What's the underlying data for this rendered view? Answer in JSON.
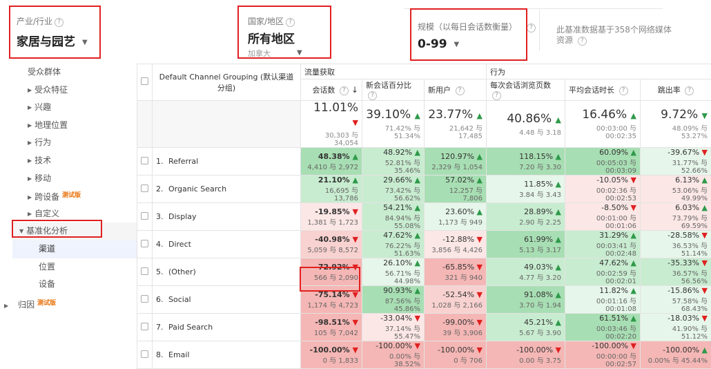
{
  "filters": {
    "industry": {
      "label": "产业/行业",
      "value": "家居与园艺"
    },
    "region": {
      "label": "国家/地区",
      "value": "所有地区",
      "sub": "加拿大"
    },
    "scale": {
      "label": "规模（以每日会话数衡量）",
      "value": "0-99"
    },
    "note": "此基准数据基于358个网络媒体资源",
    "help_glyph": "?"
  },
  "sidebar": {
    "header": "受众群体",
    "items": [
      "受众特征",
      "兴趣",
      "地理位置",
      "行为",
      "技术",
      "移动",
      "跨设备",
      "自定义"
    ],
    "beta_label": "测试版",
    "group": "基准化分析",
    "sub_items": [
      "渠道",
      "位置",
      "设备"
    ],
    "last_item": "归因"
  },
  "table": {
    "dimension_header": "Default Channel Grouping (默认渠道分组)",
    "group_acquisition": "流量获取",
    "group_behavior": "行为",
    "columns": [
      "会话数",
      "新会话百分比",
      "新用户",
      "每次会话浏览页数",
      "平均会话时长",
      "跳出率"
    ],
    "totals": [
      {
        "pct": "11.01%",
        "dir": "down",
        "sub": "30,303 与 34,054"
      },
      {
        "pct": "39.10%",
        "dir": "up",
        "sub": "71.42% 与 51.34%"
      },
      {
        "pct": "23.77%",
        "dir": "up",
        "sub": "21,642 与 17,485"
      },
      {
        "pct": "40.86%",
        "dir": "up",
        "sub": "4.48 与 3.18"
      },
      {
        "pct": "16.46%",
        "dir": "up",
        "sub": "00:03:00 与 00:02:35"
      },
      {
        "pct": "9.72%",
        "dir": "up",
        "sub": "48.09% 与 53.27%"
      }
    ],
    "rows": [
      {
        "idx": "1.",
        "name": "Referral",
        "cells": [
          {
            "pct": "48.38%",
            "dir": "up",
            "sub": "4,410 与 2,972"
          },
          {
            "pct": "48.92%",
            "dir": "up",
            "sub": "52.81% 与 35.46%"
          },
          {
            "pct": "120.97%",
            "dir": "up",
            "sub": "2,329 与 1,054"
          },
          {
            "pct": "118.15%",
            "dir": "up",
            "sub": "7.20 与 3.30"
          },
          {
            "pct": "60.09%",
            "dir": "up",
            "sub": "00:05:03 与 00:03:09"
          },
          {
            "pct": "-39.67%",
            "dir": "down",
            "sub": "31.77% 与 52.66%"
          }
        ]
      },
      {
        "idx": "2.",
        "name": "Organic Search",
        "cells": [
          {
            "pct": "21.10%",
            "dir": "up",
            "sub": "16,695 与 13,786"
          },
          {
            "pct": "29.66%",
            "dir": "up",
            "sub": "73.42% 与 56.62%"
          },
          {
            "pct": "57.02%",
            "dir": "up",
            "sub": "12,257 与 7,806"
          },
          {
            "pct": "11.85%",
            "dir": "up",
            "sub": "3.84 与 3.43"
          },
          {
            "pct": "-10.05%",
            "dir": "down",
            "sub": "00:02:36 与 00:02:53"
          },
          {
            "pct": "6.13%",
            "dir": "up",
            "sub": "53.06% 与 49.99%"
          }
        ]
      },
      {
        "idx": "3.",
        "name": "Display",
        "cells": [
          {
            "pct": "-19.85%",
            "dir": "down",
            "sub": "1,381 与 1,723"
          },
          {
            "pct": "54.21%",
            "dir": "up",
            "sub": "84.94% 与 55.08%"
          },
          {
            "pct": "23.60%",
            "dir": "up",
            "sub": "1,173 与 949"
          },
          {
            "pct": "28.89%",
            "dir": "up",
            "sub": "2.90 与 2.25"
          },
          {
            "pct": "-8.50%",
            "dir": "down",
            "sub": "00:01:00 与 00:01:06"
          },
          {
            "pct": "6.03%",
            "dir": "up",
            "sub": "73.79% 与 69.59%"
          }
        ]
      },
      {
        "idx": "4.",
        "name": "Direct",
        "cells": [
          {
            "pct": "-40.98%",
            "dir": "down",
            "sub": "5,059 与 8,572"
          },
          {
            "pct": "47.62%",
            "dir": "up",
            "sub": "76.22% 与 51.63%"
          },
          {
            "pct": "-12.88%",
            "dir": "down",
            "sub": "3,856 与 4,426"
          },
          {
            "pct": "61.99%",
            "dir": "up",
            "sub": "5.13 与 3.17"
          },
          {
            "pct": "31.29%",
            "dir": "up",
            "sub": "00:03:41 与 00:02:48"
          },
          {
            "pct": "-28.58%",
            "dir": "down",
            "sub": "36.53% 与 51.14%"
          }
        ]
      },
      {
        "idx": "5.",
        "name": "(Other)",
        "cells": [
          {
            "pct": "-72.92%",
            "dir": "down",
            "sub": "566 与 2,090"
          },
          {
            "pct": "26.10%",
            "dir": "up",
            "sub": "56.71% 与 44.98%"
          },
          {
            "pct": "-65.85%",
            "dir": "down",
            "sub": "321 与 940"
          },
          {
            "pct": "49.03%",
            "dir": "up",
            "sub": "4.77 与 3.20"
          },
          {
            "pct": "47.62%",
            "dir": "up",
            "sub": "00:02:59 与 00:02:01"
          },
          {
            "pct": "-35.33%",
            "dir": "down",
            "sub": "36.57% 与 56.56%"
          }
        ]
      },
      {
        "idx": "6.",
        "name": "Social",
        "cells": [
          {
            "pct": "-75.14%",
            "dir": "down",
            "sub": "1,174 与 4,723"
          },
          {
            "pct": "90.93%",
            "dir": "up",
            "sub": "87.56% 与 45.86%"
          },
          {
            "pct": "-52.54%",
            "dir": "down",
            "sub": "1,028 与 2,166"
          },
          {
            "pct": "91.08%",
            "dir": "up",
            "sub": "3.70 与 1.94"
          },
          {
            "pct": "11.82%",
            "dir": "up",
            "sub": "00:01:16 与 00:01:08"
          },
          {
            "pct": "-15.86%",
            "dir": "down",
            "sub": "57.58% 与 68.43%"
          }
        ]
      },
      {
        "idx": "7.",
        "name": "Paid Search",
        "cells": [
          {
            "pct": "-98.51%",
            "dir": "down",
            "sub": "105 与 7,042"
          },
          {
            "pct": "-33.04%",
            "dir": "down",
            "sub": "37.14% 与 55.47%"
          },
          {
            "pct": "-99.00%",
            "dir": "down",
            "sub": "39 与 3,906"
          },
          {
            "pct": "45.21%",
            "dir": "up",
            "sub": "5.67 与 3.90"
          },
          {
            "pct": "61.51%",
            "dir": "up",
            "sub": "00:03:46 与 00:02:20"
          },
          {
            "pct": "-18.03%",
            "dir": "down",
            "sub": "41.90% 与 51.12%"
          }
        ]
      },
      {
        "idx": "8.",
        "name": "Email",
        "cells": [
          {
            "pct": "-100.00%",
            "dir": "down",
            "sub": "0 与 1,833"
          },
          {
            "pct": "-100.00%",
            "dir": "down",
            "sub": "0.00% 与 38.52%"
          },
          {
            "pct": "-100.00%",
            "dir": "down",
            "sub": "0 与 706"
          },
          {
            "pct": "-100.00%",
            "dir": "down",
            "sub": "0.00 与 3.75"
          },
          {
            "pct": "-100.00%",
            "dir": "down",
            "sub": "00:00:00 与 00:02:57"
          },
          {
            "pct": "-100.00%",
            "dir": "up",
            "sub": "0.00% 与 45.44%"
          }
        ]
      }
    ]
  }
}
